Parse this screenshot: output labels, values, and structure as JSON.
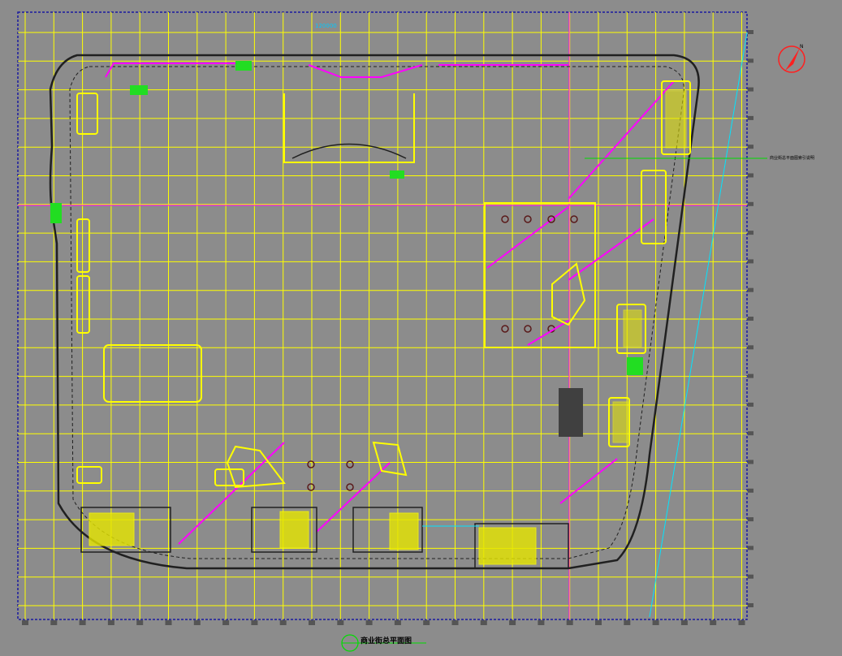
{
  "drawing": {
    "title": "商业街总平面图",
    "top_dimension": "120000",
    "side_note": "商业街总平面图索引说明"
  },
  "colors": {
    "background": "#8c8c8c",
    "grid": "#ffff00",
    "border": "#1a1aa0",
    "magenta": "#ff00ff",
    "green": "#00ff00",
    "cyan": "#00e5ff",
    "outline": "#202020",
    "north_arrow": "#ff2020"
  },
  "icons": {
    "north_arrow": "compass-north-icon",
    "title_marker": "title-circle-icon"
  }
}
